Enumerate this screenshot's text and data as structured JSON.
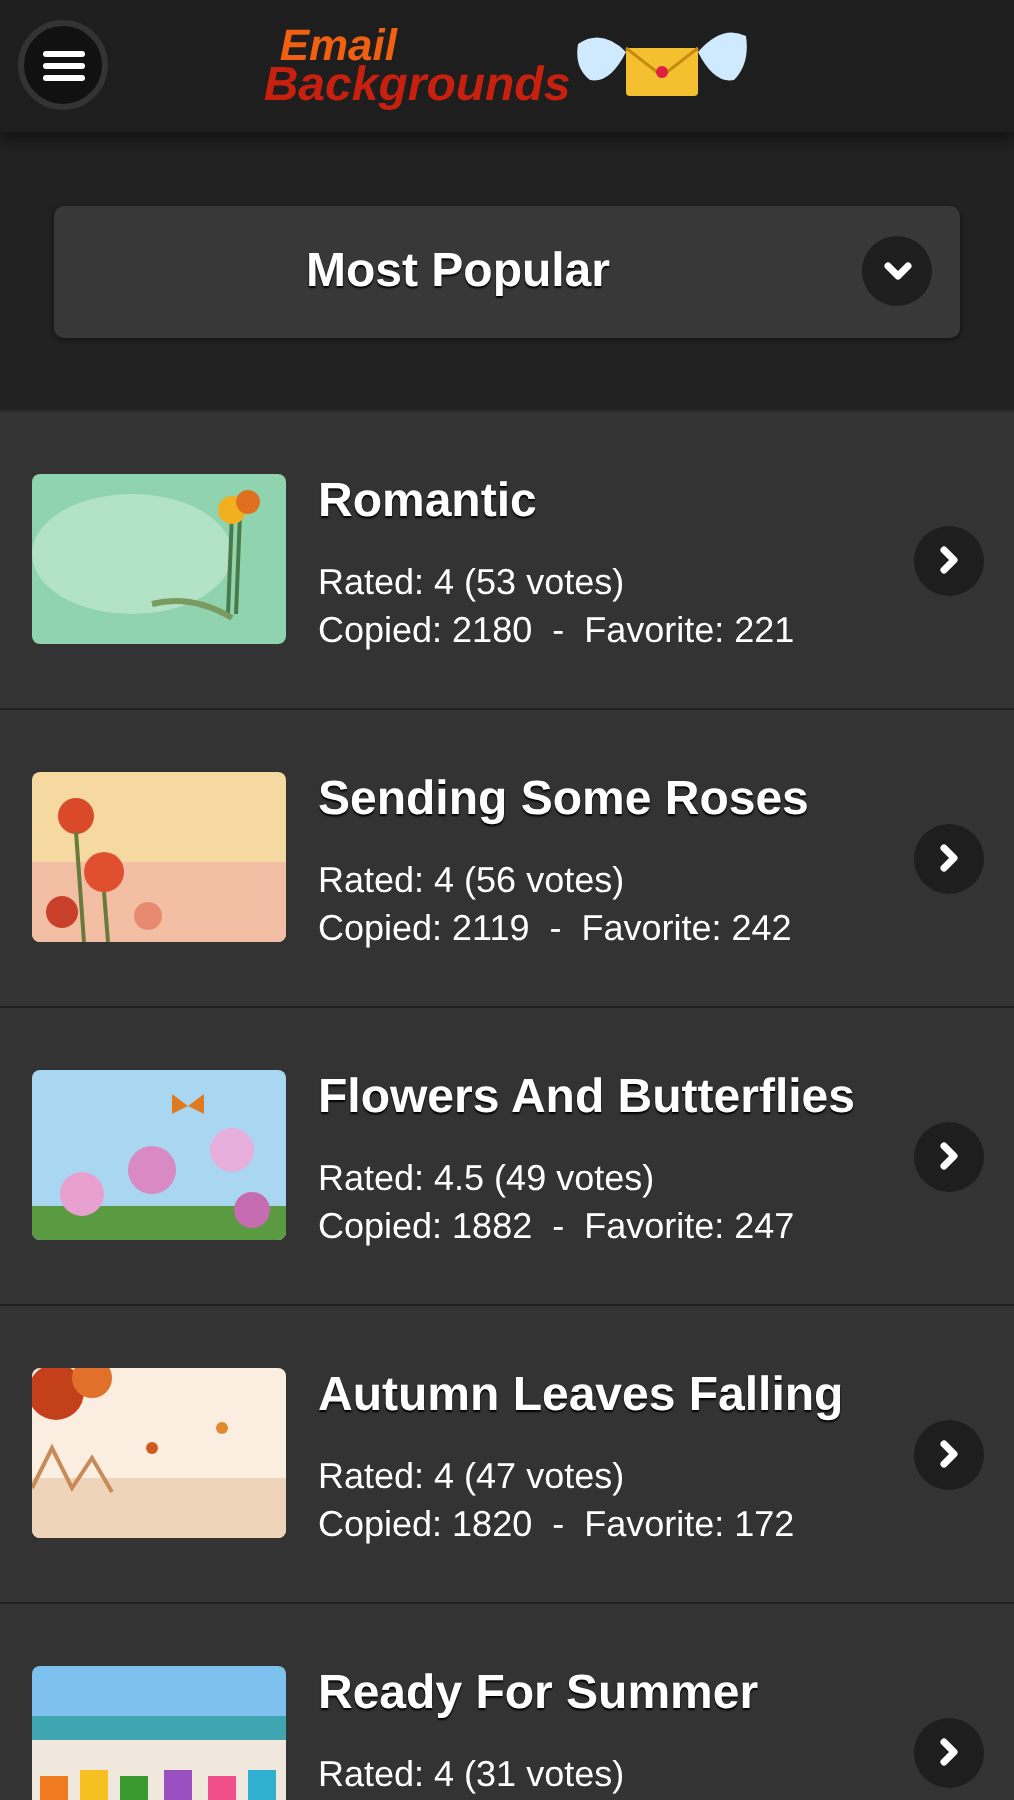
{
  "header": {
    "logo": {
      "line_1": "Email",
      "line_2": "Backgrounds"
    }
  },
  "filter": {
    "label": "Most Popular"
  },
  "items": [
    {
      "title": "Romantic",
      "rating": "Rated: 4 (53 votes)",
      "stats": "Copied: 2180  -  Favorite: 221"
    },
    {
      "title": "Sending Some Roses",
      "rating": "Rated: 4 (56 votes)",
      "stats": "Copied: 2119  -  Favorite: 242"
    },
    {
      "title": "Flowers And Butterflies",
      "rating": "Rated: 4.5 (49 votes)",
      "stats": "Copied: 1882  -  Favorite: 247"
    },
    {
      "title": "Autumn Leaves Falling",
      "rating": "Rated: 4 (47 votes)",
      "stats": "Copied: 1820  -  Favorite: 172"
    },
    {
      "title": "Ready For Summer",
      "rating": "Rated: 4 (31 votes)"
    }
  ]
}
